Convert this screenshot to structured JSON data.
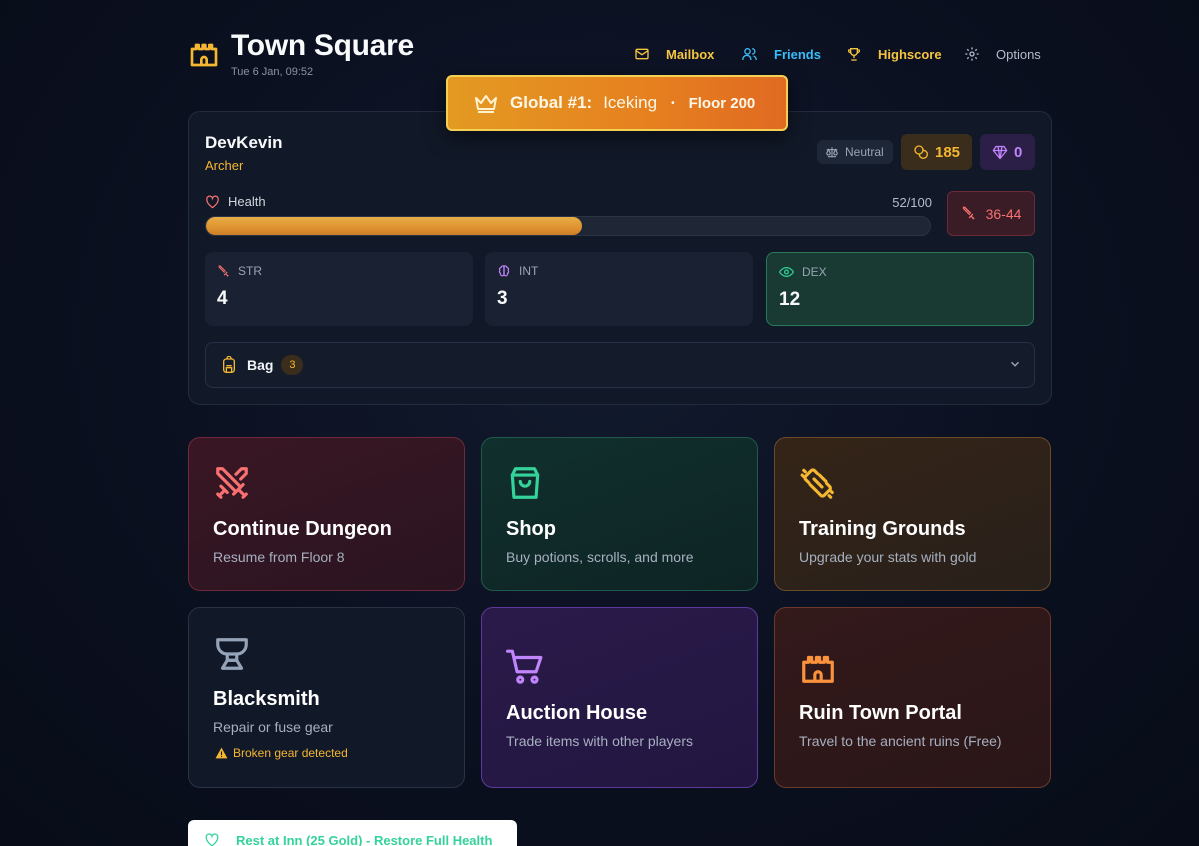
{
  "header": {
    "title": "Town Square",
    "datetime": "Tue 6 Jan, 09:52",
    "logo_icon": "castle-icon"
  },
  "nav": [
    {
      "label": "Mailbox",
      "icon": "mail-icon",
      "color": "#f5c542"
    },
    {
      "label": "Friends",
      "icon": "users-icon",
      "color": "#38bdf8"
    },
    {
      "label": "Highscore",
      "icon": "trophy-icon",
      "color": "#f5c542"
    },
    {
      "label": "Options",
      "icon": "gear-icon",
      "color": "#b4bccb"
    }
  ],
  "banner": {
    "label": "Global #1:",
    "player": "Iceking",
    "separator": "•",
    "floor": "Floor 200",
    "icon": "crown-icon"
  },
  "player": {
    "name": "DevKevin",
    "class": "Archer",
    "alignment": "Neutral",
    "gold": "185",
    "gems": "0",
    "health_label": "Health",
    "health_text": "52/100",
    "health_fraction": 0.52,
    "damage": "36-44",
    "stats": [
      {
        "label": "STR",
        "value": "4",
        "icon": "sword-icon",
        "color": "#f87171"
      },
      {
        "label": "INT",
        "value": "3",
        "icon": "brain-icon",
        "color": "#c084fc"
      },
      {
        "label": "DEX",
        "value": "12",
        "icon": "eye-icon",
        "color": "#34d399"
      }
    ],
    "bag": {
      "label": "Bag",
      "count": "3"
    }
  },
  "tiles": [
    {
      "title": "Continue Dungeon",
      "desc": "Resume from Floor 8",
      "icon": "crossed-swords-icon",
      "color": "#f87171"
    },
    {
      "title": "Shop",
      "desc": "Buy potions, scrolls, and more",
      "icon": "shopping-bag-icon",
      "color": "#34d399"
    },
    {
      "title": "Training Grounds",
      "desc": "Upgrade your stats with gold",
      "icon": "dumbbell-icon",
      "color": "#f5b731"
    },
    {
      "title": "Blacksmith",
      "desc": "Repair or fuse gear",
      "warning": "Broken gear detected",
      "icon": "anvil-icon",
      "color": "#94a3b8"
    },
    {
      "title": "Auction House",
      "desc": "Trade items with other players",
      "icon": "shopping-cart-icon",
      "color": "#c084fc"
    },
    {
      "title": "Ruin Town Portal",
      "desc": "Travel to the ancient ruins (Free)",
      "icon": "castle-icon",
      "color": "#fb923c"
    }
  ],
  "inn_button": {
    "label": "Rest at Inn (25 Gold) - Restore Full Health",
    "icon": "heart-icon"
  }
}
